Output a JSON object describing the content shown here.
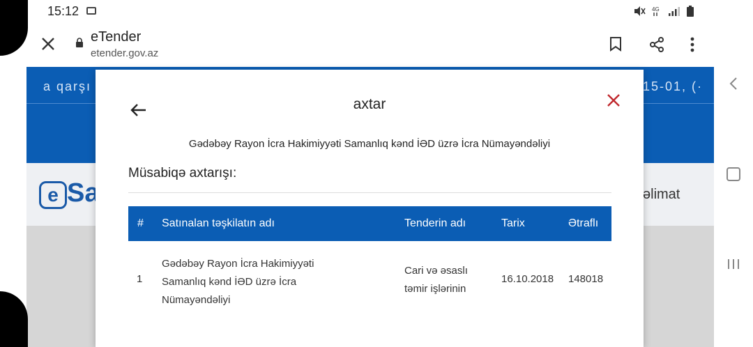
{
  "status_bar": {
    "time": "15:12",
    "right_icons": [
      "mute-icon",
      "4g-signal-icon",
      "signal-bars-icon",
      "battery-icon"
    ]
  },
  "browser": {
    "site_title": "eTender",
    "url": "etender.gov.az"
  },
  "background_page": {
    "band_left_text": "a qarşı",
    "band_right_text": "15-01, (·",
    "logo_text": "Sa",
    "logo_letter": "e",
    "right_label": "əlimat"
  },
  "modal": {
    "title": "axtar",
    "organization": "Gədəbəy Rayon İcra Hakimiyyəti Samanlıq kənd İƏD üzrə İcra Nümayəndəliyi",
    "section_title": "Müsabiqə axtarışı:",
    "table": {
      "headers": [
        "#",
        "Satınalan təşkilatın adı",
        "Tenderin adı",
        "Tarix",
        "Ətraflı"
      ],
      "rows": [
        {
          "index": "1",
          "org_name_lines": [
            "Gədəbəy Rayon İcra Hakimiyyəti",
            "Samanlıq kənd İƏD üzrə İcra",
            "Nümayəndəliyi"
          ],
          "tender_name_lines": [
            "Cari və əsaslı",
            "təmir işlərinin"
          ],
          "date": "16.10.2018",
          "details": "148018"
        }
      ]
    }
  },
  "colors": {
    "primary_blue": "#0b5db4",
    "close_red": "#c0282d"
  }
}
